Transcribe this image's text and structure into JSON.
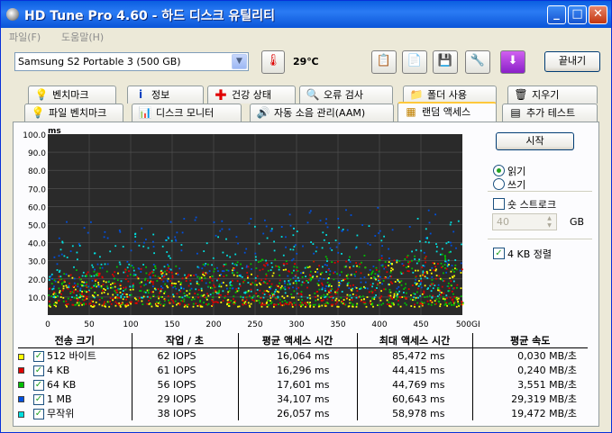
{
  "window": {
    "title": "HD Tune Pro 4.60 - 하드 디스크 유틸리티"
  },
  "menu": {
    "items": [
      "파일(F)",
      "도움말(H)"
    ]
  },
  "toolbar": {
    "drive": "Samsung S2 Portable 3    (500 GB)",
    "temperature": "29℃",
    "exit_label": "끝내기"
  },
  "tabs": {
    "row1": [
      "벤치마크",
      "정보",
      "건강 상태",
      "오류 검사",
      "폴더 사용",
      "지우기"
    ],
    "row2": [
      "파일 벤치마크",
      "디스크 모니터",
      "자동 소음 관리(AAM)",
      "랜덤 액세스",
      "추가 테스트"
    ]
  },
  "side": {
    "start_label": "시작",
    "read_label": "읽기",
    "write_label": "쓰기",
    "short_stroke_label": "숏 스트로크",
    "short_stroke_value": "40",
    "short_stroke_unit": "GB",
    "align_label": "4 KB 정렬"
  },
  "table": {
    "headers": [
      "전송 크기",
      "작업 / 초",
      "평균 액세스 시간",
      "최대 액세스 시간",
      "평균 속도"
    ],
    "rows": [
      {
        "size": "512 바이트",
        "ops": "62 IOPS",
        "avg": "16,064 ms",
        "max": "85,472 ms",
        "speed": "0,030 MB/초",
        "color": "#ffff00"
      },
      {
        "size": "4 KB",
        "ops": "61 IOPS",
        "avg": "16,296 ms",
        "max": "44,415 ms",
        "speed": "0,240 MB/초",
        "color": "#e00000"
      },
      {
        "size": "64 KB",
        "ops": "56 IOPS",
        "avg": "17,601 ms",
        "max": "44,769 ms",
        "speed": "3,551 MB/초",
        "color": "#00c000"
      },
      {
        "size": "1 MB",
        "ops": "29 IOPS",
        "avg": "34,107 ms",
        "max": "60,643 ms",
        "speed": "29,319 MB/초",
        "color": "#0050e0"
      },
      {
        "size": "무작위",
        "ops": "38 IOPS",
        "avg": "26,057 ms",
        "max": "58,978 ms",
        "speed": "19,472 MB/초",
        "color": "#00e0e0"
      }
    ]
  },
  "chart_data": {
    "type": "scatter",
    "ylabel": "ms",
    "xlabel_unit": "GB",
    "ylim": [
      0,
      100
    ],
    "xlim": [
      0,
      500
    ],
    "y_ticks": [
      "100.0",
      "90.0",
      "80.0",
      "70.0",
      "60.0",
      "50.0",
      "40.0",
      "30.0",
      "20.0",
      "10.0"
    ],
    "x_ticks": [
      "0",
      "50",
      "100",
      "150",
      "200",
      "250",
      "300",
      "350",
      "400",
      "450",
      "500GB"
    ],
    "grid": true,
    "series": [
      {
        "name": "512 바이트",
        "color": "#ffff00",
        "y_range": [
          5,
          22
        ]
      },
      {
        "name": "4 KB",
        "color": "#e00000",
        "y_range": [
          6,
          24
        ]
      },
      {
        "name": "64 KB",
        "color": "#00c000",
        "y_range": [
          6,
          26
        ]
      },
      {
        "name": "1 MB",
        "color": "#0050e0",
        "y_range": [
          15,
          52
        ]
      },
      {
        "name": "무작위",
        "color": "#00e0e0",
        "y_range": [
          10,
          45
        ]
      }
    ]
  }
}
